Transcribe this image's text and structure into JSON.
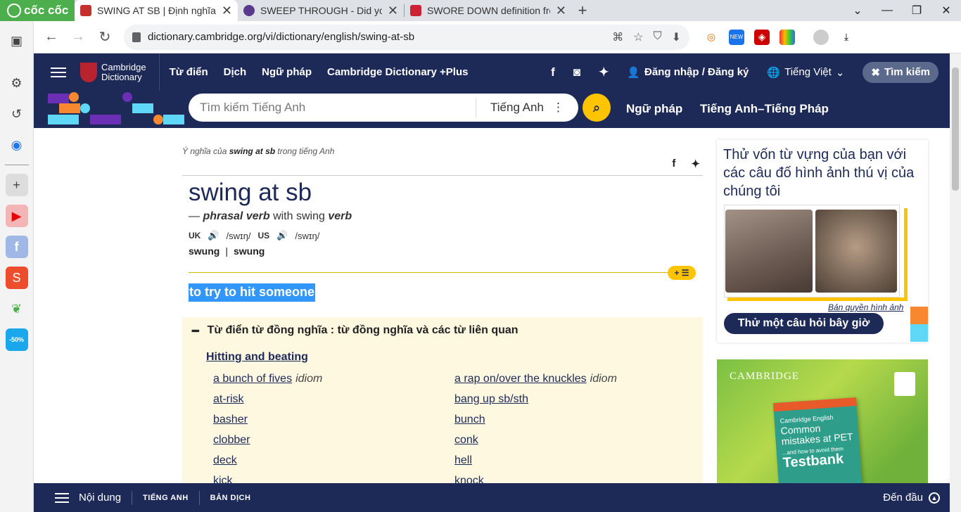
{
  "browser": {
    "brand": "cốc cốc",
    "tabs": [
      {
        "title": "SWING AT SB | Định nghĩa tro",
        "color": "#c4302b"
      },
      {
        "title": "SWEEP THROUGH - Did you s",
        "color": "#5a3a8c"
      },
      {
        "title": "SWORE DOWN definition fro",
        "color": "#cc2233"
      }
    ],
    "url": "dictionary.cambridge.org/vi/dictionary/english/swing-at-sb"
  },
  "nav": {
    "logo_line1": "Cambridge",
    "logo_line2": "Dictionary",
    "links": [
      "Từ điển",
      "Dịch",
      "Ngữ pháp",
      "Cambridge Dictionary +Plus"
    ],
    "login": "Đăng nhập / Đăng ký",
    "language": "Tiếng Việt",
    "search_button": "Tìm kiếm"
  },
  "search": {
    "placeholder": "Tìm kiếm Tiếng Anh",
    "dictionary": "Tiếng Anh",
    "link1": "Ngữ pháp",
    "link2": "Tiếng Anh–Tiếng Pháp"
  },
  "entry": {
    "crumb_prefix": "Ý nghĩa của",
    "crumb_word": "swing at sb",
    "crumb_suffix": "trong tiếng Anh",
    "headword": "swing at sb",
    "pos_dash": "—",
    "pos": "phrasal verb",
    "pos_with": "with swing",
    "pos_verb": "verb",
    "uk_label": "UK",
    "uk_ipa": "/swɪŋ/",
    "us_label": "US",
    "us_ipa": "/swɪŋ/",
    "form1": "swung",
    "form_sep": "|",
    "form2": "swung",
    "addlist": "+ ☰",
    "definition": "to try to hit someone"
  },
  "thesaurus": {
    "title": "Từ điển từ đồng nghĩa : từ đồng nghĩa và các từ liên quan",
    "category": "Hitting and beating",
    "left": [
      {
        "text": "a bunch of fives",
        "tag": "idiom"
      },
      {
        "text": "at-risk",
        "tag": ""
      },
      {
        "text": "basher",
        "tag": ""
      },
      {
        "text": "clobber",
        "tag": ""
      },
      {
        "text": "deck",
        "tag": ""
      },
      {
        "text": "kick",
        "tag": ""
      }
    ],
    "right": [
      {
        "text": "a rap on/over the knuckles",
        "tag": "idiom"
      },
      {
        "text": "bang up sb/sth",
        "tag": ""
      },
      {
        "text": "bunch",
        "tag": ""
      },
      {
        "text": "conk",
        "tag": ""
      },
      {
        "text": "hell",
        "tag": ""
      },
      {
        "text": "knock",
        "tag": ""
      }
    ]
  },
  "quiz": {
    "text": "Thử vốn từ vựng của bạn với các câu đố hình ảnh thú vị của chúng tôi",
    "copyright": "Bản quyền hình ảnh",
    "button": "Thử một câu hỏi bây giờ"
  },
  "ad": {
    "brand": "CAMBRIDGE",
    "book_series": "Cambridge English",
    "book_title": "Common mistakes at PET",
    "book_sub": "...and how to avoid them",
    "book_word": "Testbank"
  },
  "bottom": {
    "contents": "Nội dung",
    "link1": "TIẾNG ANH",
    "link2": "BẢN DỊCH",
    "top": "Đến đầu"
  },
  "colors": {
    "navy": "#1d2a57",
    "yellow": "#fec400",
    "highlight": "#3297fd"
  }
}
